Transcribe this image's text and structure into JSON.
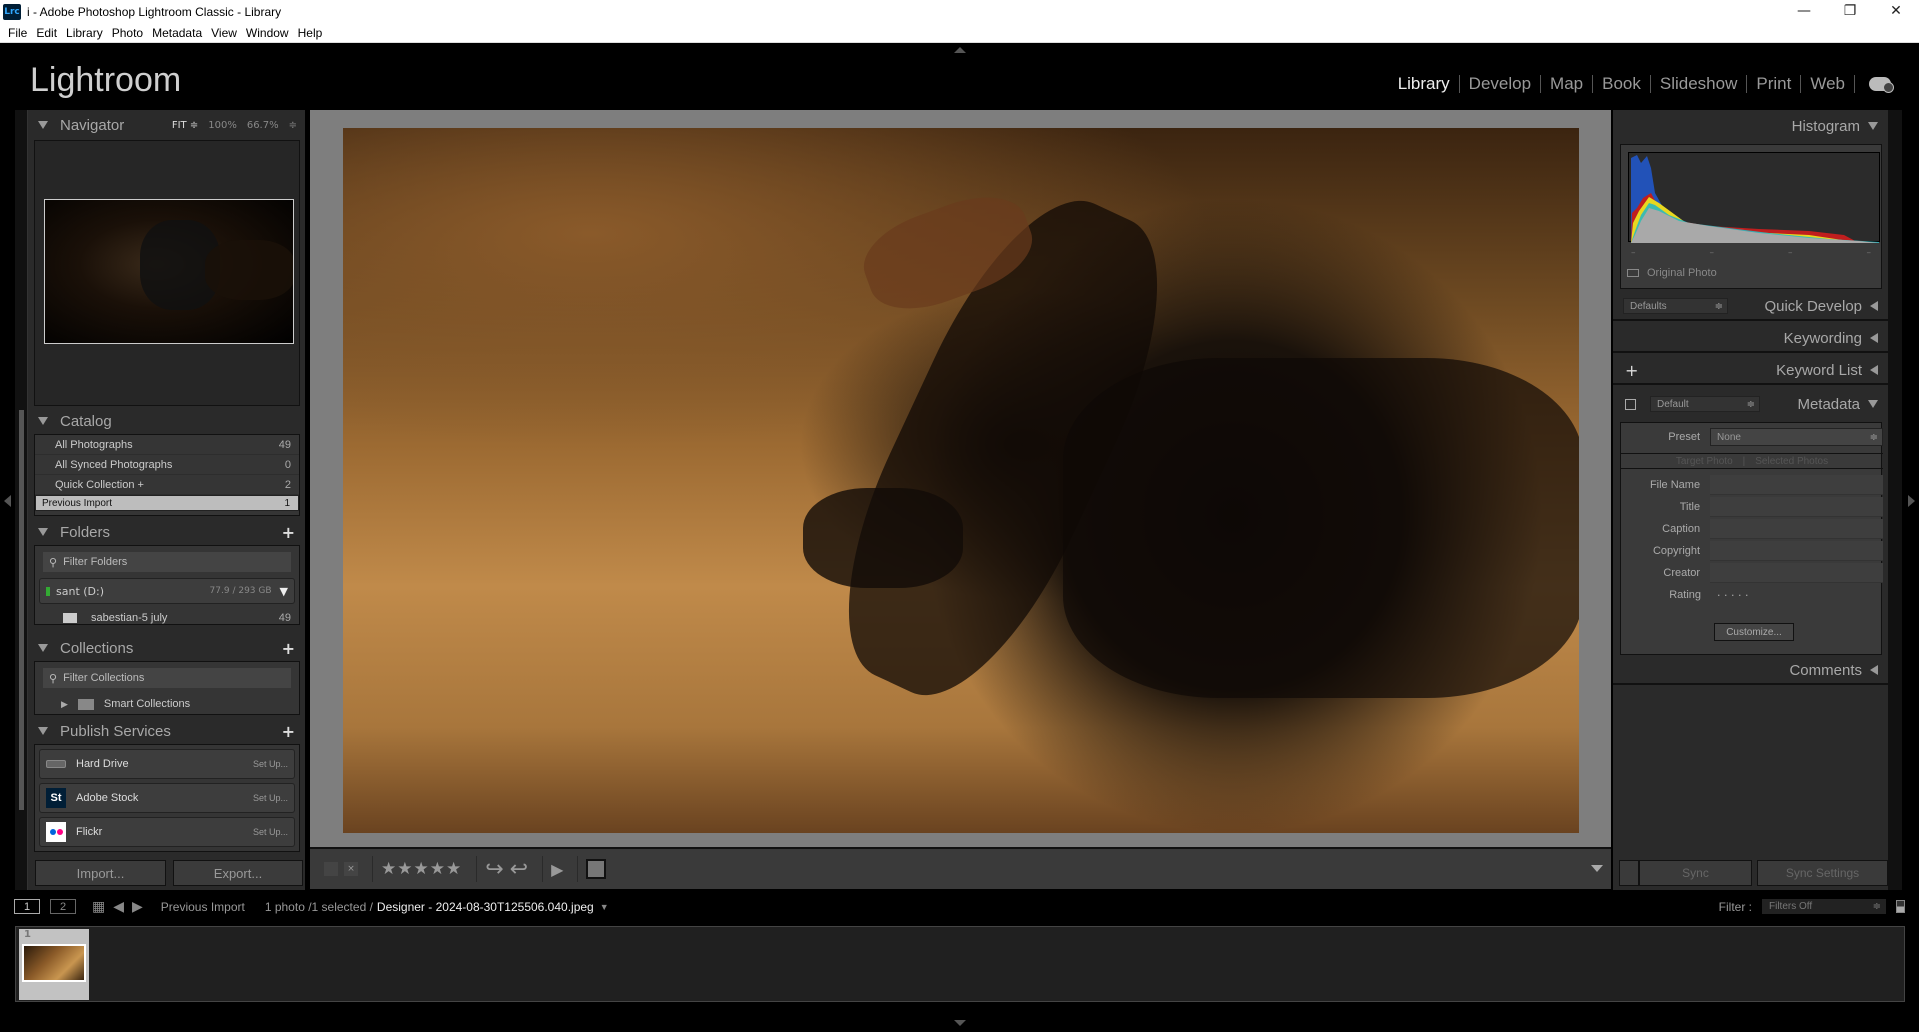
{
  "window": {
    "app_icon": "Lrc",
    "title": "i - Adobe Photoshop Lightroom Classic - Library",
    "controls": {
      "minimize": "—",
      "maximize": "❐",
      "close": "✕"
    }
  },
  "menu": [
    "File",
    "Edit",
    "Library",
    "Photo",
    "Metadata",
    "View",
    "Window",
    "Help"
  ],
  "brand": "Lightroom",
  "modules": [
    {
      "label": "Library",
      "active": true
    },
    {
      "label": "Develop",
      "active": false
    },
    {
      "label": "Map",
      "active": false
    },
    {
      "label": "Book",
      "active": false
    },
    {
      "label": "Slideshow",
      "active": false
    },
    {
      "label": "Print",
      "active": false
    },
    {
      "label": "Web",
      "active": false
    }
  ],
  "left": {
    "navigator": {
      "title": "Navigator",
      "fit": "FIT ≑",
      "zoom1": "100%",
      "zoom2": "66.7%",
      "zoom_arrows": "≑"
    },
    "catalog": {
      "title": "Catalog",
      "items": [
        {
          "label": "All Photographs",
          "count": "49"
        },
        {
          "label": "All Synced Photographs",
          "count": "0"
        },
        {
          "label": "Quick Collection +",
          "count": "2"
        },
        {
          "label": "Previous Import",
          "count": "1",
          "selected": true
        }
      ]
    },
    "folders": {
      "title": "Folders",
      "filter_placeholder": "Filter Folders",
      "drive": {
        "name": "sant (D:)",
        "size": "77.9 / 293 GB"
      },
      "items": [
        {
          "label": "sabestian-5 july",
          "count": "49"
        }
      ]
    },
    "collections": {
      "title": "Collections",
      "filter_placeholder": "Filter Collections",
      "items": [
        {
          "label": "Smart Collections"
        }
      ]
    },
    "publish": {
      "title": "Publish Services",
      "items": [
        {
          "label": "Hard Drive",
          "action": "Set Up..."
        },
        {
          "label": "Adobe Stock",
          "action": "Set Up...",
          "icon": "St"
        },
        {
          "label": "Flickr",
          "action": "Set Up..."
        }
      ]
    },
    "import_label": "Import...",
    "export_label": "Export..."
  },
  "toolbar": {
    "rating_stars": "★★★★★",
    "rotate_left": "↪",
    "rotate_right": "↩",
    "play": "▶"
  },
  "right": {
    "histogram": {
      "title": "Histogram",
      "original_photo": "Original Photo"
    },
    "quick_develop": {
      "title": "Quick Develop",
      "preset": "Defaults"
    },
    "keywording": {
      "title": "Keywording"
    },
    "keyword_list": {
      "title": "Keyword List",
      "add": "+"
    },
    "metadata": {
      "title": "Metadata",
      "preset_select": "Default",
      "preset_label": "Preset",
      "preset_value": "None",
      "target_tabs": [
        "Target Photo",
        "Selected Photos"
      ],
      "fields": [
        {
          "label": "File Name",
          "value": ""
        },
        {
          "label": "Title",
          "value": ""
        },
        {
          "label": "Caption",
          "value": ""
        },
        {
          "label": "Copyright",
          "value": ""
        },
        {
          "label": "Creator",
          "value": ""
        }
      ],
      "rating_label": "Rating",
      "rating_value": "· · · · ·",
      "customize": "Customize..."
    },
    "comments": {
      "title": "Comments"
    },
    "sync_label": "Sync",
    "sync_settings_label": "Sync Settings"
  },
  "filmbar": {
    "view1": "1",
    "view2": "2",
    "source": "Previous Import",
    "count": "1 photo /1 selected /",
    "filename": "Designer - 2024-08-30T125506.040.jpeg",
    "filter_label": "Filter :",
    "filter_value": "Filters Off"
  },
  "filmstrip": [
    {
      "index": "1"
    }
  ]
}
